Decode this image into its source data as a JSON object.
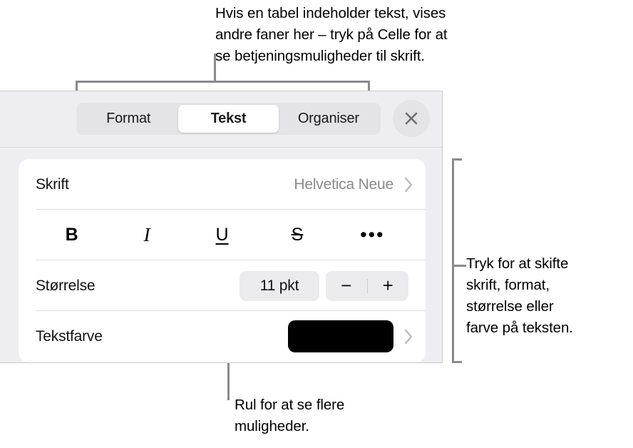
{
  "callouts": {
    "top": "Hvis en tabel indeholder tekst, vises\nandre faner her – tryk på Celle for at\nse betjeningsmuligheder til skrift.",
    "right": "Tryk for at skifte\nskrift, format,\nstørrelse eller\nfarve på teksten.",
    "bottom": "Rul for at se flere\nmuligheder."
  },
  "inspector": {
    "tabs": [
      {
        "label": "Format",
        "selected": false
      },
      {
        "label": "Tekst",
        "selected": true
      },
      {
        "label": "Organiser",
        "selected": false
      }
    ],
    "close_icon": "close-icon",
    "rows": {
      "font": {
        "label": "Skrift",
        "value": "Helvetica Neue",
        "disclosure_icon": "chevron-right-icon"
      },
      "style": {
        "buttons": [
          {
            "label": "B",
            "name": "bold-button"
          },
          {
            "label": "I",
            "name": "italic-button"
          },
          {
            "label": "U",
            "name": "underline-button"
          },
          {
            "label": "S",
            "name": "strikethrough-button"
          },
          {
            "label": "•••",
            "name": "more-options-button"
          }
        ]
      },
      "size": {
        "label": "Størrelse",
        "value": "11 pkt",
        "decrement_label": "−",
        "increment_label": "+"
      },
      "text_color": {
        "label": "Tekstfarve",
        "swatch_color": "#000000",
        "disclosure_icon": "chevron-right-icon"
      }
    }
  },
  "colors": {
    "panel_background": "#eeeef2",
    "card_background": "#ffffff",
    "segment_track": "#e3e3e8",
    "accent_text": "#8a8a8e",
    "leader_line": "#8a8a8e"
  }
}
